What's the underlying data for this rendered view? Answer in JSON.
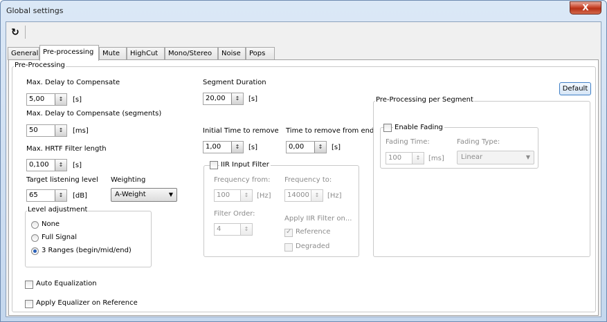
{
  "window": {
    "title": "Global settings",
    "close_label": "X"
  },
  "tabs": [
    {
      "label": "General"
    },
    {
      "label": "Pre-processing",
      "active": true
    },
    {
      "label": "Mute"
    },
    {
      "label": "HighCut"
    },
    {
      "label": "Mono/Stereo"
    },
    {
      "label": "Noise"
    },
    {
      "label": "Pops"
    }
  ],
  "icons": {
    "refresh": "refresh-icon",
    "spin": "spin-arrows-icon",
    "dropdown": "dropdown-arrow-icon"
  },
  "colors": {
    "title_bar": "#c4d7ee",
    "close_button": "#c7442a",
    "default_button_border": "#3f7fc6"
  },
  "pre": {
    "group_title": "Pre-Processing",
    "max_delay": {
      "label": "Max. Delay to Compensate",
      "value": "5,00",
      "unit": "[s]"
    },
    "max_delay_seg": {
      "label": "Max. Delay to Compensate (segments)",
      "value": "50",
      "unit": "[ms]"
    },
    "hrtf": {
      "label": "Max. HRTF Filter length",
      "value": "0,100",
      "unit": "[s]"
    },
    "target": {
      "label": "Target listening level",
      "value": "65",
      "unit": "[dB]"
    },
    "weighting": {
      "label": "Weighting",
      "value": "A-Weight"
    },
    "level_adjustment": {
      "title": "Level adjustment",
      "options": [
        {
          "label": "None",
          "checked": false
        },
        {
          "label": "Full Signal",
          "checked": false
        },
        {
          "label": "3 Ranges (begin/mid/end)",
          "checked": true
        }
      ]
    },
    "segment_duration": {
      "label": "Segment Duration",
      "value": "20,00",
      "unit": "[s]"
    },
    "initial_time": {
      "label": "Initial Time to remove",
      "value": "1,00",
      "unit": "[s]"
    },
    "time_end": {
      "label": "Time to remove from end",
      "value": "0,00",
      "unit": "[s]"
    },
    "iir": {
      "title": "IIR Input Filter",
      "freq_from": {
        "label": "Frequency from:",
        "value": "100",
        "unit": "[Hz]"
      },
      "freq_to": {
        "label": "Frequency to:",
        "value": "14000",
        "unit": "[Hz]"
      },
      "order": {
        "label": "Filter Order:",
        "value": "4"
      },
      "apply_label": "Apply IIR Filter on...",
      "reference": {
        "label": "Reference",
        "checked": true
      },
      "degraded": {
        "label": "Degraded",
        "checked": false
      }
    },
    "default_button": "Default",
    "per_segment": {
      "title": "Pre-Processing per Segment",
      "fading": {
        "title": "Enable Fading",
        "time": {
          "label": "Fading Time:",
          "value": "100",
          "unit": "[ms]"
        },
        "type": {
          "label": "Fading Type:",
          "value": "Linear"
        }
      }
    },
    "auto_eq": {
      "label": "Auto Equalization",
      "checked": false
    },
    "apply_eq": {
      "label": "Apply Equalizer on Reference",
      "checked": false
    }
  }
}
